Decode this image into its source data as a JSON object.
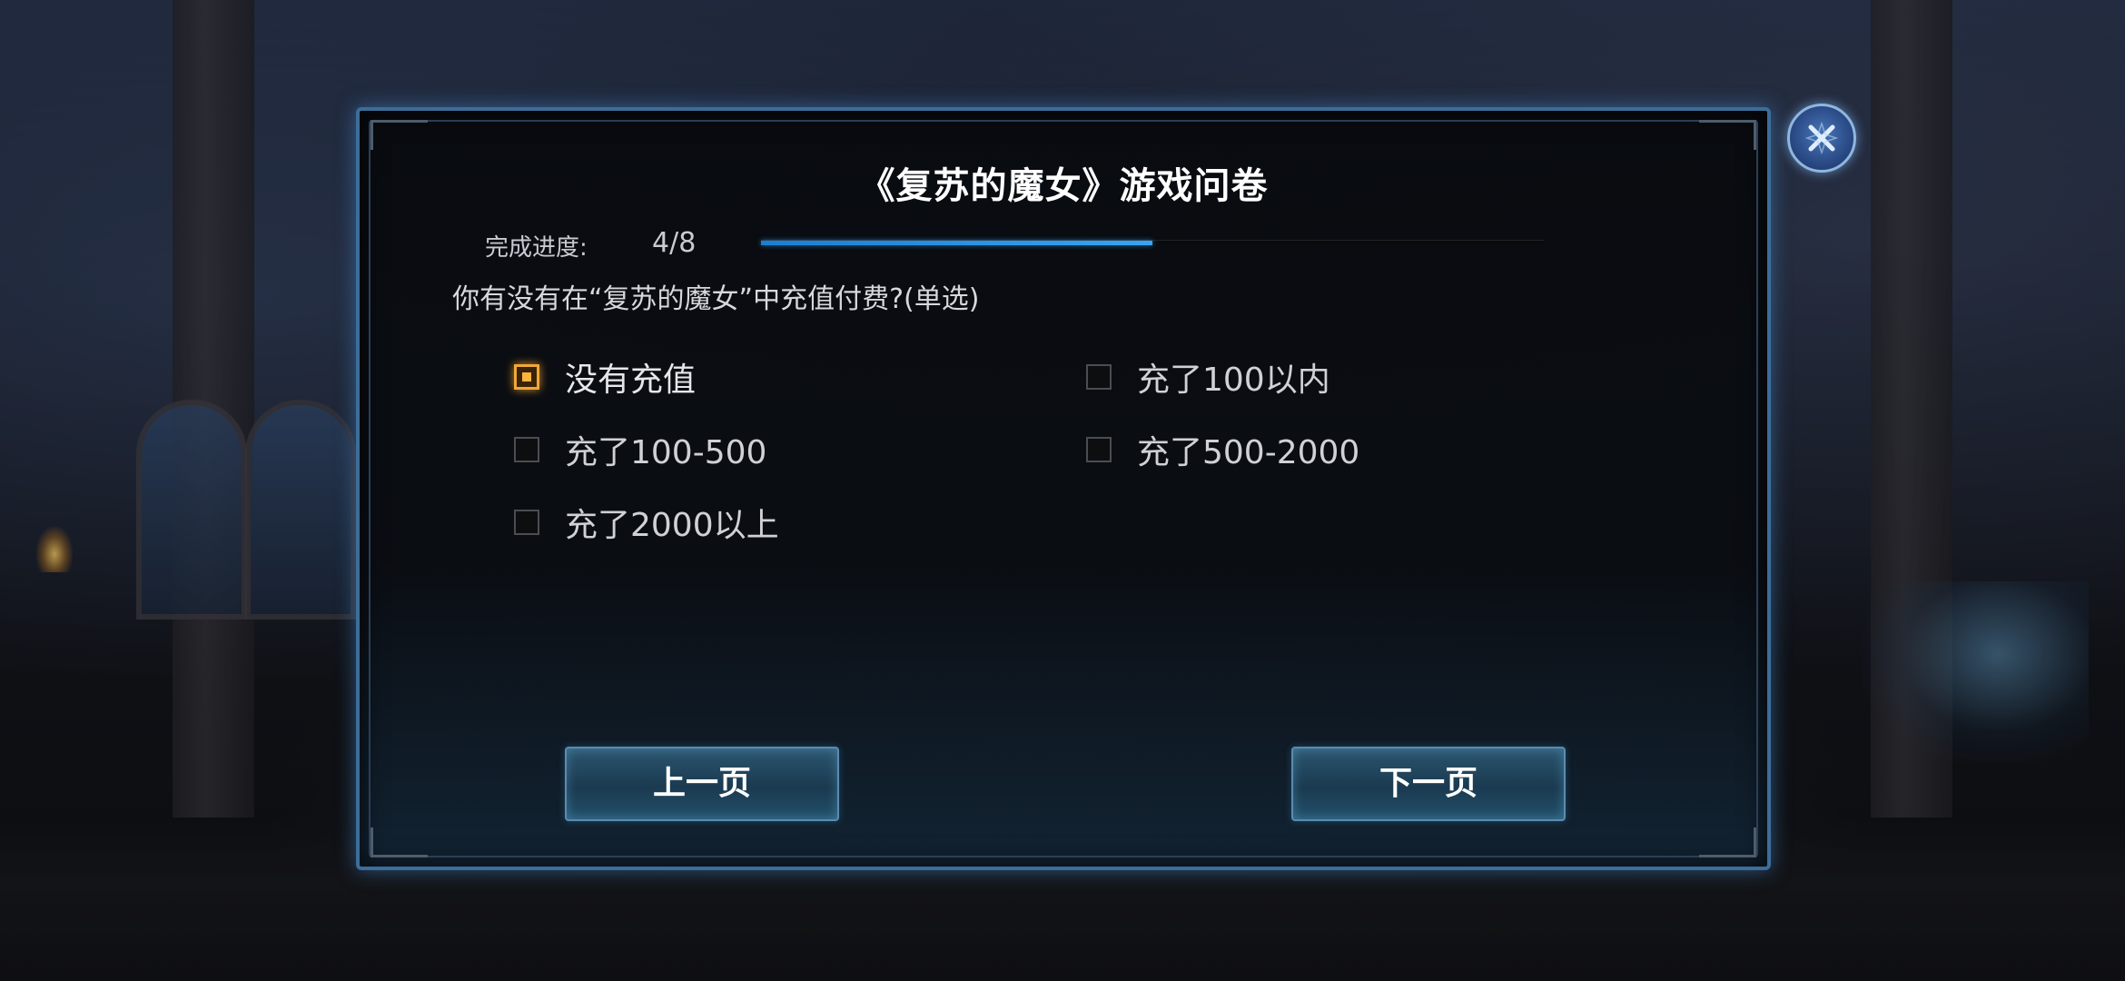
{
  "survey": {
    "title": "《复苏的魔女》游戏问卷",
    "progress_label": "完成进度:",
    "progress_text": "4/8",
    "progress_fraction": 0.5,
    "question": "你有没有在“复苏的魔女”中充值付费?(单选)",
    "options": [
      {
        "label": "没有充值",
        "selected": true
      },
      {
        "label": "充了100以内",
        "selected": false
      },
      {
        "label": "充了100-500",
        "selected": false
      },
      {
        "label": "充了500-2000",
        "selected": false
      },
      {
        "label": "充了2000以上",
        "selected": false
      }
    ],
    "prev_label": "上一页",
    "next_label": "下一页"
  },
  "colors": {
    "accent_progress": "#2a8fe0",
    "selected_checkbox": "#f0a838",
    "dialog_border": "#3d6d99"
  },
  "icons": {
    "close": "close-icon"
  }
}
